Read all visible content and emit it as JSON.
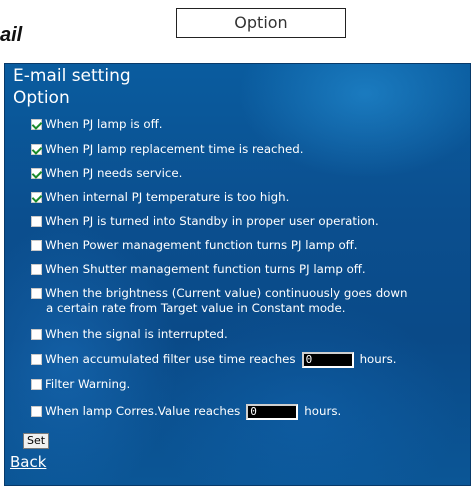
{
  "header": {
    "doc_word": "ail",
    "option_box_label": "Option"
  },
  "panel": {
    "title": "E-mail setting",
    "subtitle": "Option",
    "options": [
      {
        "label": "When PJ lamp is off.",
        "checked": true
      },
      {
        "label": "When PJ lamp replacement time is reached.",
        "checked": true
      },
      {
        "label": "When PJ needs service.",
        "checked": true
      },
      {
        "label": "When internal PJ temperature is too high.",
        "checked": true
      },
      {
        "label": "When PJ is turned into Standby in proper user operation.",
        "checked": false
      },
      {
        "label": "When Power management function turns PJ lamp off.",
        "checked": false
      },
      {
        "label": "When Shutter management function turns PJ lamp off.",
        "checked": false
      },
      {
        "label_line1": "When the brightness (Current value) continuously goes down",
        "label_line2": "a certain rate from Target value in Constant mode.",
        "checked": false
      },
      {
        "label": "When the signal is interrupted.",
        "checked": false
      },
      {
        "label": "When accumulated filter use time reaches",
        "input_value": "0",
        "suffix": "hours.",
        "checked": false
      },
      {
        "label": "Filter Warning.",
        "checked": false
      },
      {
        "label": "When lamp Corres.Value reaches",
        "input_value": "0",
        "suffix": "hours.",
        "checked": false
      }
    ],
    "set_label": "Set",
    "back_label": "Back"
  }
}
